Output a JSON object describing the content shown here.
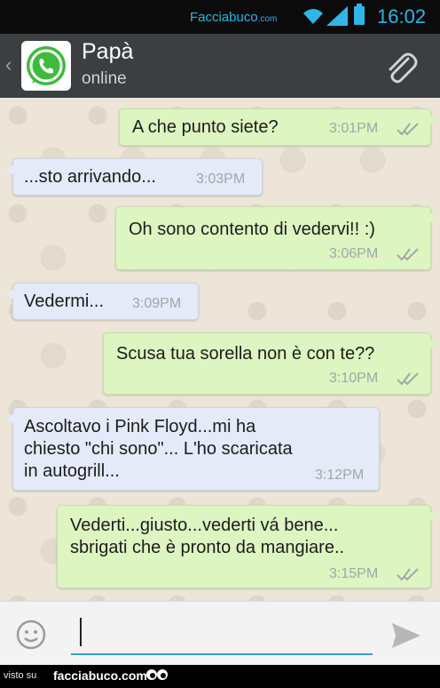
{
  "status_bar": {
    "site": "Facciabuco",
    "site_suffix": ".com",
    "time": "16:02",
    "color": "#2fb5e6"
  },
  "header": {
    "back_icon": "chevron-left-icon",
    "avatar_icon": "whatsapp-logo-icon",
    "contact_name": "Papà",
    "contact_status": "online",
    "attach_icon": "paperclip-icon"
  },
  "messages": [
    {
      "direction": "out",
      "text": "A che punto siete?",
      "time": "3:01PM",
      "ticks": "double-check-icon"
    },
    {
      "direction": "in",
      "text": "...sto arrivando...",
      "time": "3:03PM"
    },
    {
      "direction": "out",
      "text": "Oh sono contento di vedervi!! :)",
      "time": "3:06PM",
      "ticks": "double-check-icon"
    },
    {
      "direction": "in",
      "text": "Vedermi...",
      "time": "3:09PM"
    },
    {
      "direction": "out",
      "text": "Scusa tua sorella non è con te??",
      "time": "3:10PM",
      "ticks": "double-check-icon"
    },
    {
      "direction": "in",
      "text": "Ascoltavo i Pink Floyd...mi ha\nchiesto \"chi sono\"... L'ho scaricata\nin autogrill...",
      "time": "3:12PM"
    },
    {
      "direction": "out",
      "text": "Vederti...giusto...vederti vá bene...\nsbrigati che è pronto da mangiare..",
      "time": "3:15PM",
      "ticks": "double-check-icon"
    }
  ],
  "input_bar": {
    "emoji_icon": "smiley-icon",
    "value": "",
    "send_icon": "send-icon"
  },
  "footer": {
    "prefix": "visto su",
    "site": "facciabuco.com"
  },
  "colors": {
    "outgoing_bubble": "#ddf5c0",
    "incoming_bubble": "#e4eaf7",
    "chat_background": "#ece5d8",
    "header": "#3b3f41"
  }
}
